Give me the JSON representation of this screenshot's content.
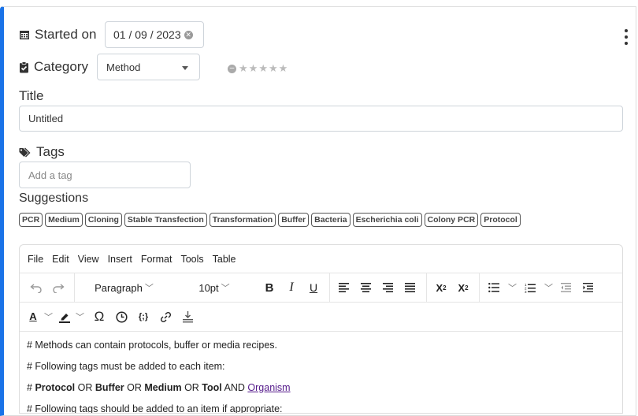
{
  "started_on": {
    "label": "Started on",
    "date": "01 / 09 / 2023"
  },
  "category": {
    "label": "Category",
    "selected": "Method"
  },
  "title": {
    "label": "Title",
    "value": "Untitled"
  },
  "tags": {
    "label": "Tags",
    "placeholder": "Add a tag"
  },
  "suggestions": {
    "label": "Suggestions",
    "items": [
      "PCR",
      "Medium",
      "Cloning",
      "Stable Transfection",
      "Transformation",
      "Buffer",
      "Bacteria",
      "Escherichia coli",
      "Colony PCR",
      "Protocol"
    ]
  },
  "editor": {
    "menu": [
      "File",
      "Edit",
      "View",
      "Insert",
      "Format",
      "Tools",
      "Table"
    ],
    "block_format": "Paragraph",
    "font_size": "10pt",
    "lines": {
      "l1": "# Methods can contain protocols, buffer or media recipes.",
      "l2": "# Following tags must be added to each item:",
      "l3_prefix": "# ",
      "l3_protocol": "Protocol",
      "l3_or1": " OR ",
      "l3_buffer": "Buffer",
      "l3_or2": " OR ",
      "l3_medium": "Medium",
      "l3_or3": " OR ",
      "l3_tool": "Tool",
      "l3_and": " AND ",
      "l3_organism": "Organism",
      "l4": "# Following tags should be added to an item if appropriate:"
    }
  },
  "colors": {
    "accent": "#1a73e8"
  }
}
